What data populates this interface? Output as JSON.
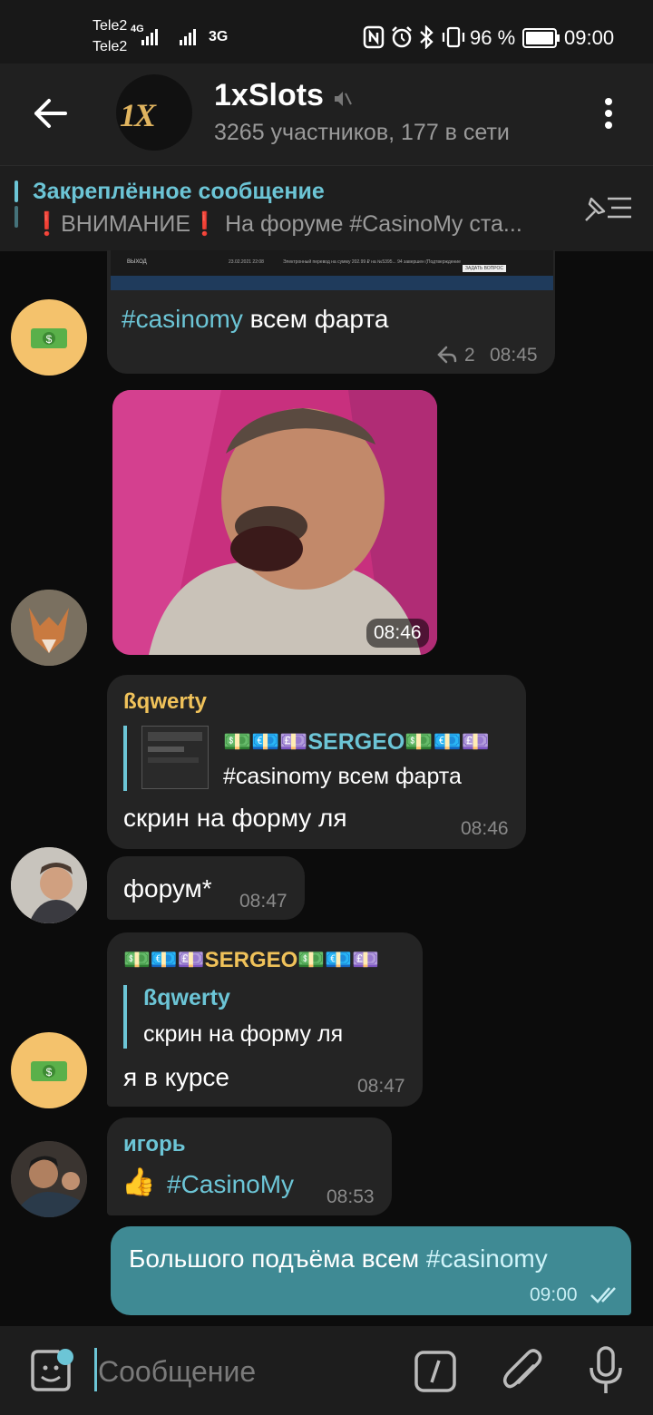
{
  "status": {
    "carrier1": "Tele2",
    "carrier2": "Tele2",
    "net1": "4G",
    "net2": "3G",
    "battery_pct": "96 %",
    "time": "09:00"
  },
  "header": {
    "title": "1xSlots",
    "subtitle": "3265 участников, 177 в сети",
    "avatar_text": "1X"
  },
  "pinned": {
    "label": "Закреплённое сообщение",
    "text": "❗ВНИМАНИЕ❗  На форуме #CasinoMy ста..."
  },
  "screenshot_snippet": {
    "left_label": "ВЫХОД",
    "date": "23.02.2021 22:08",
    "description": "Электронный перевод на сумму 202.99 ₽ на №5395... 94 завершен (Подтверждение",
    "ask_button": "ЗАДАТЬ ВОПРОС"
  },
  "messages": {
    "m1": {
      "tag": "#casinomy",
      "text": " всем фарта",
      "replies": "2",
      "time": "08:45"
    },
    "m2": {
      "time": "08:46"
    },
    "m3": {
      "sender": "ßqwerty",
      "reply_author": "💵💶💷SERGEO💵💶💷",
      "reply_text": "#casinomy  всем фарта",
      "text": "скрин на форму ля",
      "time": "08:46"
    },
    "m4": {
      "text": "форум*",
      "time": "08:47"
    },
    "m5": {
      "sender": "💵💶💷SERGEO💵💶💷",
      "reply_author": "ßqwerty",
      "reply_text": "скрин на форму ля",
      "text": "я в курсе",
      "time": "08:47"
    },
    "m6": {
      "sender": "игорь",
      "emoji": "👍",
      "tag": "#CasinoMy",
      "time": "08:53"
    },
    "m7": {
      "text": "Большого подъёма всем ",
      "tag": "#casinomy",
      "time": "09:00"
    }
  },
  "input": {
    "placeholder": "Сообщение"
  },
  "colors": {
    "accent": "#6cc5d6",
    "own_bubble": "#3f8a94",
    "sender_yellow": "#f0c25a",
    "bubble": "#242424"
  }
}
